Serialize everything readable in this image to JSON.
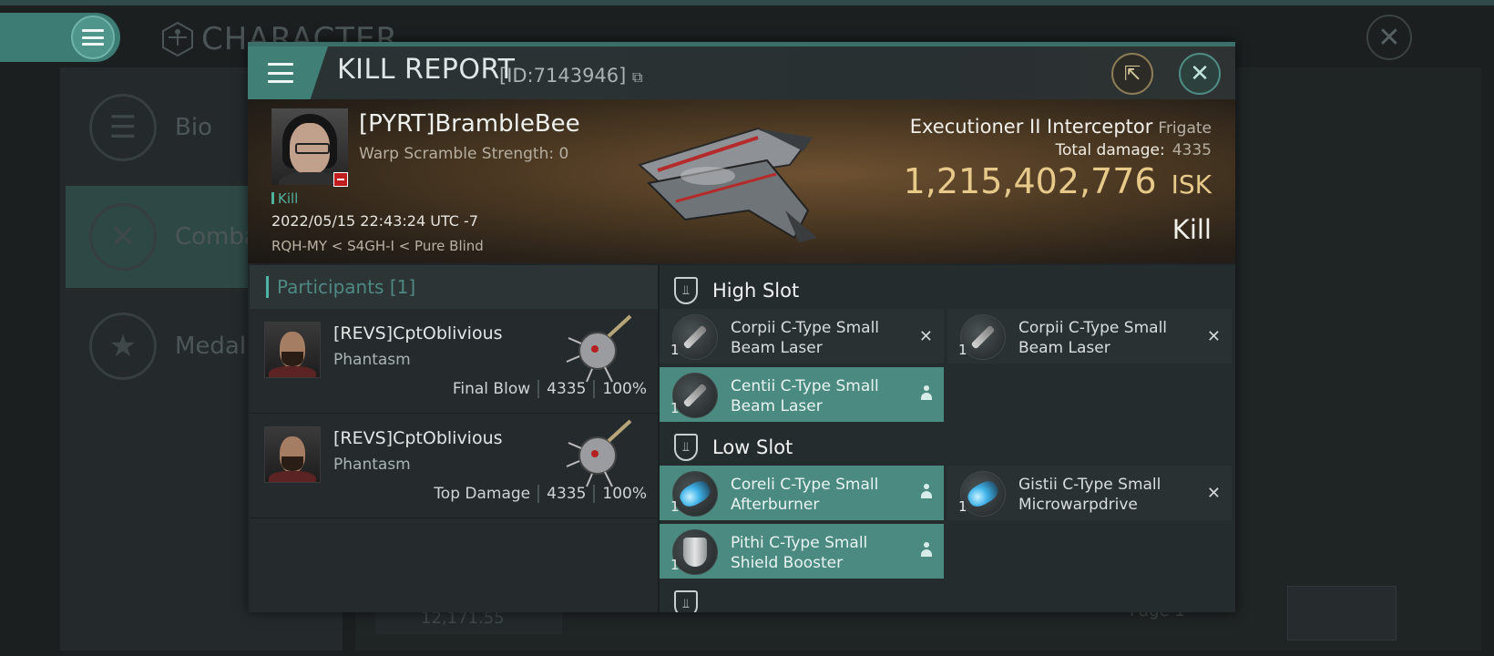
{
  "background": {
    "screen_title": "CHARACTER",
    "nav": [
      {
        "label": "Bio",
        "icon": "list-icon"
      },
      {
        "label": "Comba",
        "icon": "crossed-swords-icon"
      },
      {
        "label": "Medal",
        "icon": "star-medal-icon"
      }
    ],
    "footer_value": "12,171.55",
    "page_label": "Page 1"
  },
  "modal": {
    "title": "KILL REPORT",
    "id_label": "[ID:7143946]",
    "copy_icon": "copy-icon",
    "share_icon": "external-link-icon",
    "close_icon": "close-icon"
  },
  "victim": {
    "name": "[PYRT]BrambleBee",
    "warp_scramble": "Warp Scramble Strength: 0",
    "tag": "Kill",
    "datetime": "2022/05/15 22:43:24 UTC -7",
    "location": "RQH-MY < S4GH-I < Pure Blind",
    "ship_name": "Executioner II Interceptor",
    "ship_class": "Frigate",
    "total_damage_label": "Total damage:",
    "total_damage_value": "4335",
    "isk_value": "1,215,402,776",
    "isk_unit": "ISK",
    "result": "Kill"
  },
  "participants": {
    "title": "Participants [1]",
    "rows": [
      {
        "name": "[REVS]CptOblivious",
        "ship": "Phantasm",
        "role": "Final Blow",
        "damage": "4335",
        "percent": "100%"
      },
      {
        "name": "[REVS]CptOblivious",
        "ship": "Phantasm",
        "role": "Top Damage",
        "damage": "4335",
        "percent": "100%"
      }
    ]
  },
  "fitting": {
    "high_slot": {
      "label": "High Slot",
      "modules": [
        {
          "name": "Corpii C-Type Small Beam Laser",
          "qty": "1",
          "state": "destroyed"
        },
        {
          "name": "Corpii C-Type Small Beam Laser",
          "qty": "1",
          "state": "destroyed"
        },
        {
          "name": "Centii C-Type Small Beam Laser",
          "qty": "1",
          "state": "dropped"
        }
      ]
    },
    "low_slot": {
      "label": "Low Slot",
      "modules": [
        {
          "name": "Coreli C-Type Small Afterburner",
          "qty": "1",
          "state": "dropped"
        },
        {
          "name": "Gistii C-Type Small Microwarpdrive",
          "qty": "1",
          "state": "destroyed"
        },
        {
          "name": "Pithi C-Type Small Shield Booster",
          "qty": "1",
          "state": "dropped"
        }
      ]
    },
    "colors": {
      "dropped_highlight": "#4b8a81",
      "destroyed_bg": "#2a3133"
    }
  },
  "colors": {
    "accent": "#4fb3a6",
    "isk": "#e7c98a",
    "danger_flag": "#c01e1e"
  }
}
